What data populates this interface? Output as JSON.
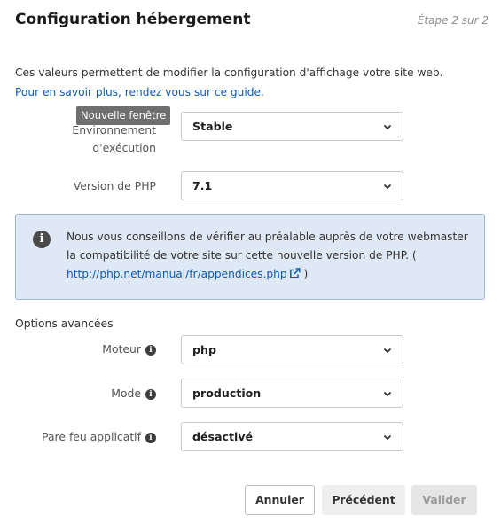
{
  "header": {
    "title": "Configuration hébergement",
    "step": "Étape 2 sur 2"
  },
  "intro": {
    "line1": "Ces valeurs permettent de modifier la configuration d'affichage votre site web.",
    "line2_link": "Pour en savoir plus, rendez vous sur ce guide."
  },
  "tooltip": {
    "text": "Nouvelle fenêtre"
  },
  "fields": {
    "environment": {
      "label_line1": "Environnement",
      "label_line2": "d'exécution",
      "value": "Stable"
    },
    "php_version": {
      "label": "Version de PHP",
      "value": "7.1"
    }
  },
  "alert": {
    "icon": "info-icon",
    "text": "Nous vous conseillons de vérifier au préalable auprès de votre webmaster la compatibilité de votre site sur cette nouvelle version de PHP. ( ",
    "link": "http://php.net/manual/fr/appendices.php",
    "text_end": " )"
  },
  "advanced": {
    "title": "Options avancées",
    "engine": {
      "label": "Moteur",
      "value": "php"
    },
    "mode": {
      "label": "Mode",
      "value": "production"
    },
    "firewall": {
      "label": "Pare feu applicatif",
      "value": "désactivé"
    }
  },
  "buttons": {
    "cancel": "Annuler",
    "previous": "Précédent",
    "validate": "Valider"
  },
  "colors": {
    "link": "#0e5bb5",
    "alert_background": "#dfe8f5",
    "alert_border": "#9fb6d4"
  }
}
